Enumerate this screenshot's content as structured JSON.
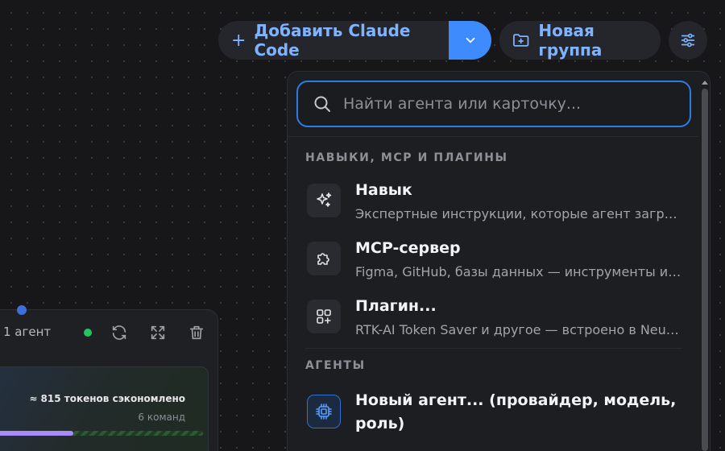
{
  "toolbar": {
    "add_label": "Добавить Claude Code",
    "group_label": "Новая группа"
  },
  "agent_card": {
    "count_label": "1 агент",
    "saved_label": "≈ 815 токенов сэкономлено",
    "commands_label": "6 команд",
    "progress": 0.38
  },
  "menu": {
    "search_placeholder": "Найти агента или карточку...",
    "section_skills": "НАВЫКИ, MCP И ПЛАГИНЫ",
    "section_agents": "АГЕНТЫ",
    "items": [
      {
        "title": "Навык",
        "desc": "Экспертные инструкции, которые агент загружает…",
        "icon": "sparkles-icon"
      },
      {
        "title": "MCP-сервер",
        "desc": "Figma, GitHub, базы данных — инструменты из…",
        "icon": "puzzle-icon"
      },
      {
        "title": "Плагин...",
        "desc": "RTK-AI Token Saver и другое — встроено в Neural…",
        "icon": "blocks-icon"
      }
    ],
    "agent_item": {
      "title": "Новый агент... (провайдер, модель, роль)",
      "icon": "chip-icon"
    }
  },
  "colors": {
    "accent": "#3d8bfd",
    "link": "#7fb3ff",
    "status_ok": "#22c55e",
    "progress": "#a78bfa"
  }
}
